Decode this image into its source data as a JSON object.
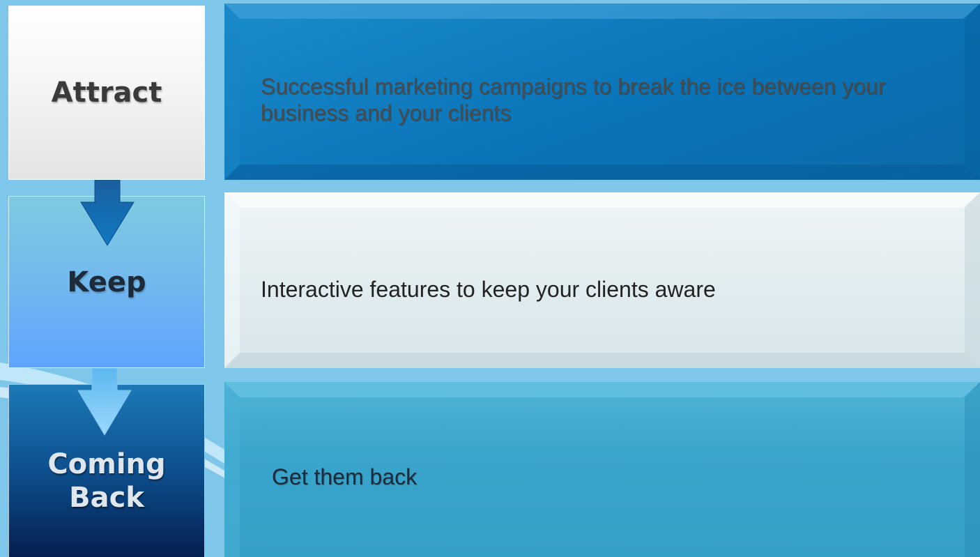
{
  "steps": [
    {
      "label": "Attract",
      "description": "Successful marketing campaigns to break the ice between your business and your clients"
    },
    {
      "label": "Keep",
      "description": "Interactive features to keep your clients aware"
    },
    {
      "label": "Coming Back",
      "label_line1": "Coming",
      "label_line2": "Back",
      "description": "Get them back"
    }
  ],
  "colors": {
    "background": "#7fc7ea",
    "panel1": "#0a74b8",
    "panel2": "#e2edf0",
    "panel3": "#3aa5cc",
    "arrow1": "#0d67ad",
    "arrow2": "#7ecbf3"
  }
}
